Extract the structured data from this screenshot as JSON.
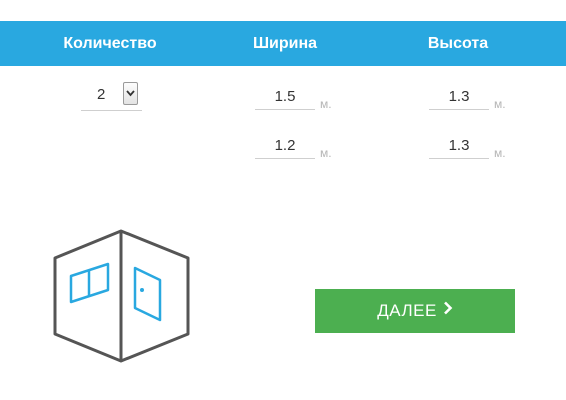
{
  "header": {
    "quantity_label": "Количество",
    "width_label": "Ширина",
    "height_label": "Высота",
    "background_color": "#29a8e0"
  },
  "quantity": {
    "selected": "2"
  },
  "rows": [
    {
      "width": "1.5",
      "height": "1.3"
    },
    {
      "width": "1.2",
      "height": "1.3"
    }
  ],
  "unit": "м.",
  "next_button": {
    "label": "ДАЛЕЕ",
    "icon": "chevron-right-icon",
    "color": "#4caf50"
  },
  "illustration": {
    "icon": "room-icon",
    "accent_color": "#29a8e0"
  }
}
